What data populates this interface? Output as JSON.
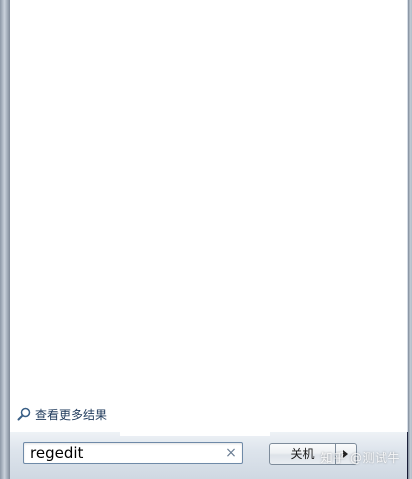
{
  "start_menu": {
    "more_results_label": "查看更多结果",
    "search": {
      "value": "regedit",
      "clear_glyph": "×"
    },
    "shutdown": {
      "label": "关机"
    }
  },
  "watermark": {
    "text": "知乎 @测试牛"
  },
  "icons": {
    "search": "search-icon",
    "clear": "close-icon",
    "arrow": "triangle-right-icon"
  },
  "colors": {
    "link_text": "#1e395b",
    "input_border": "#6f8aa8"
  }
}
